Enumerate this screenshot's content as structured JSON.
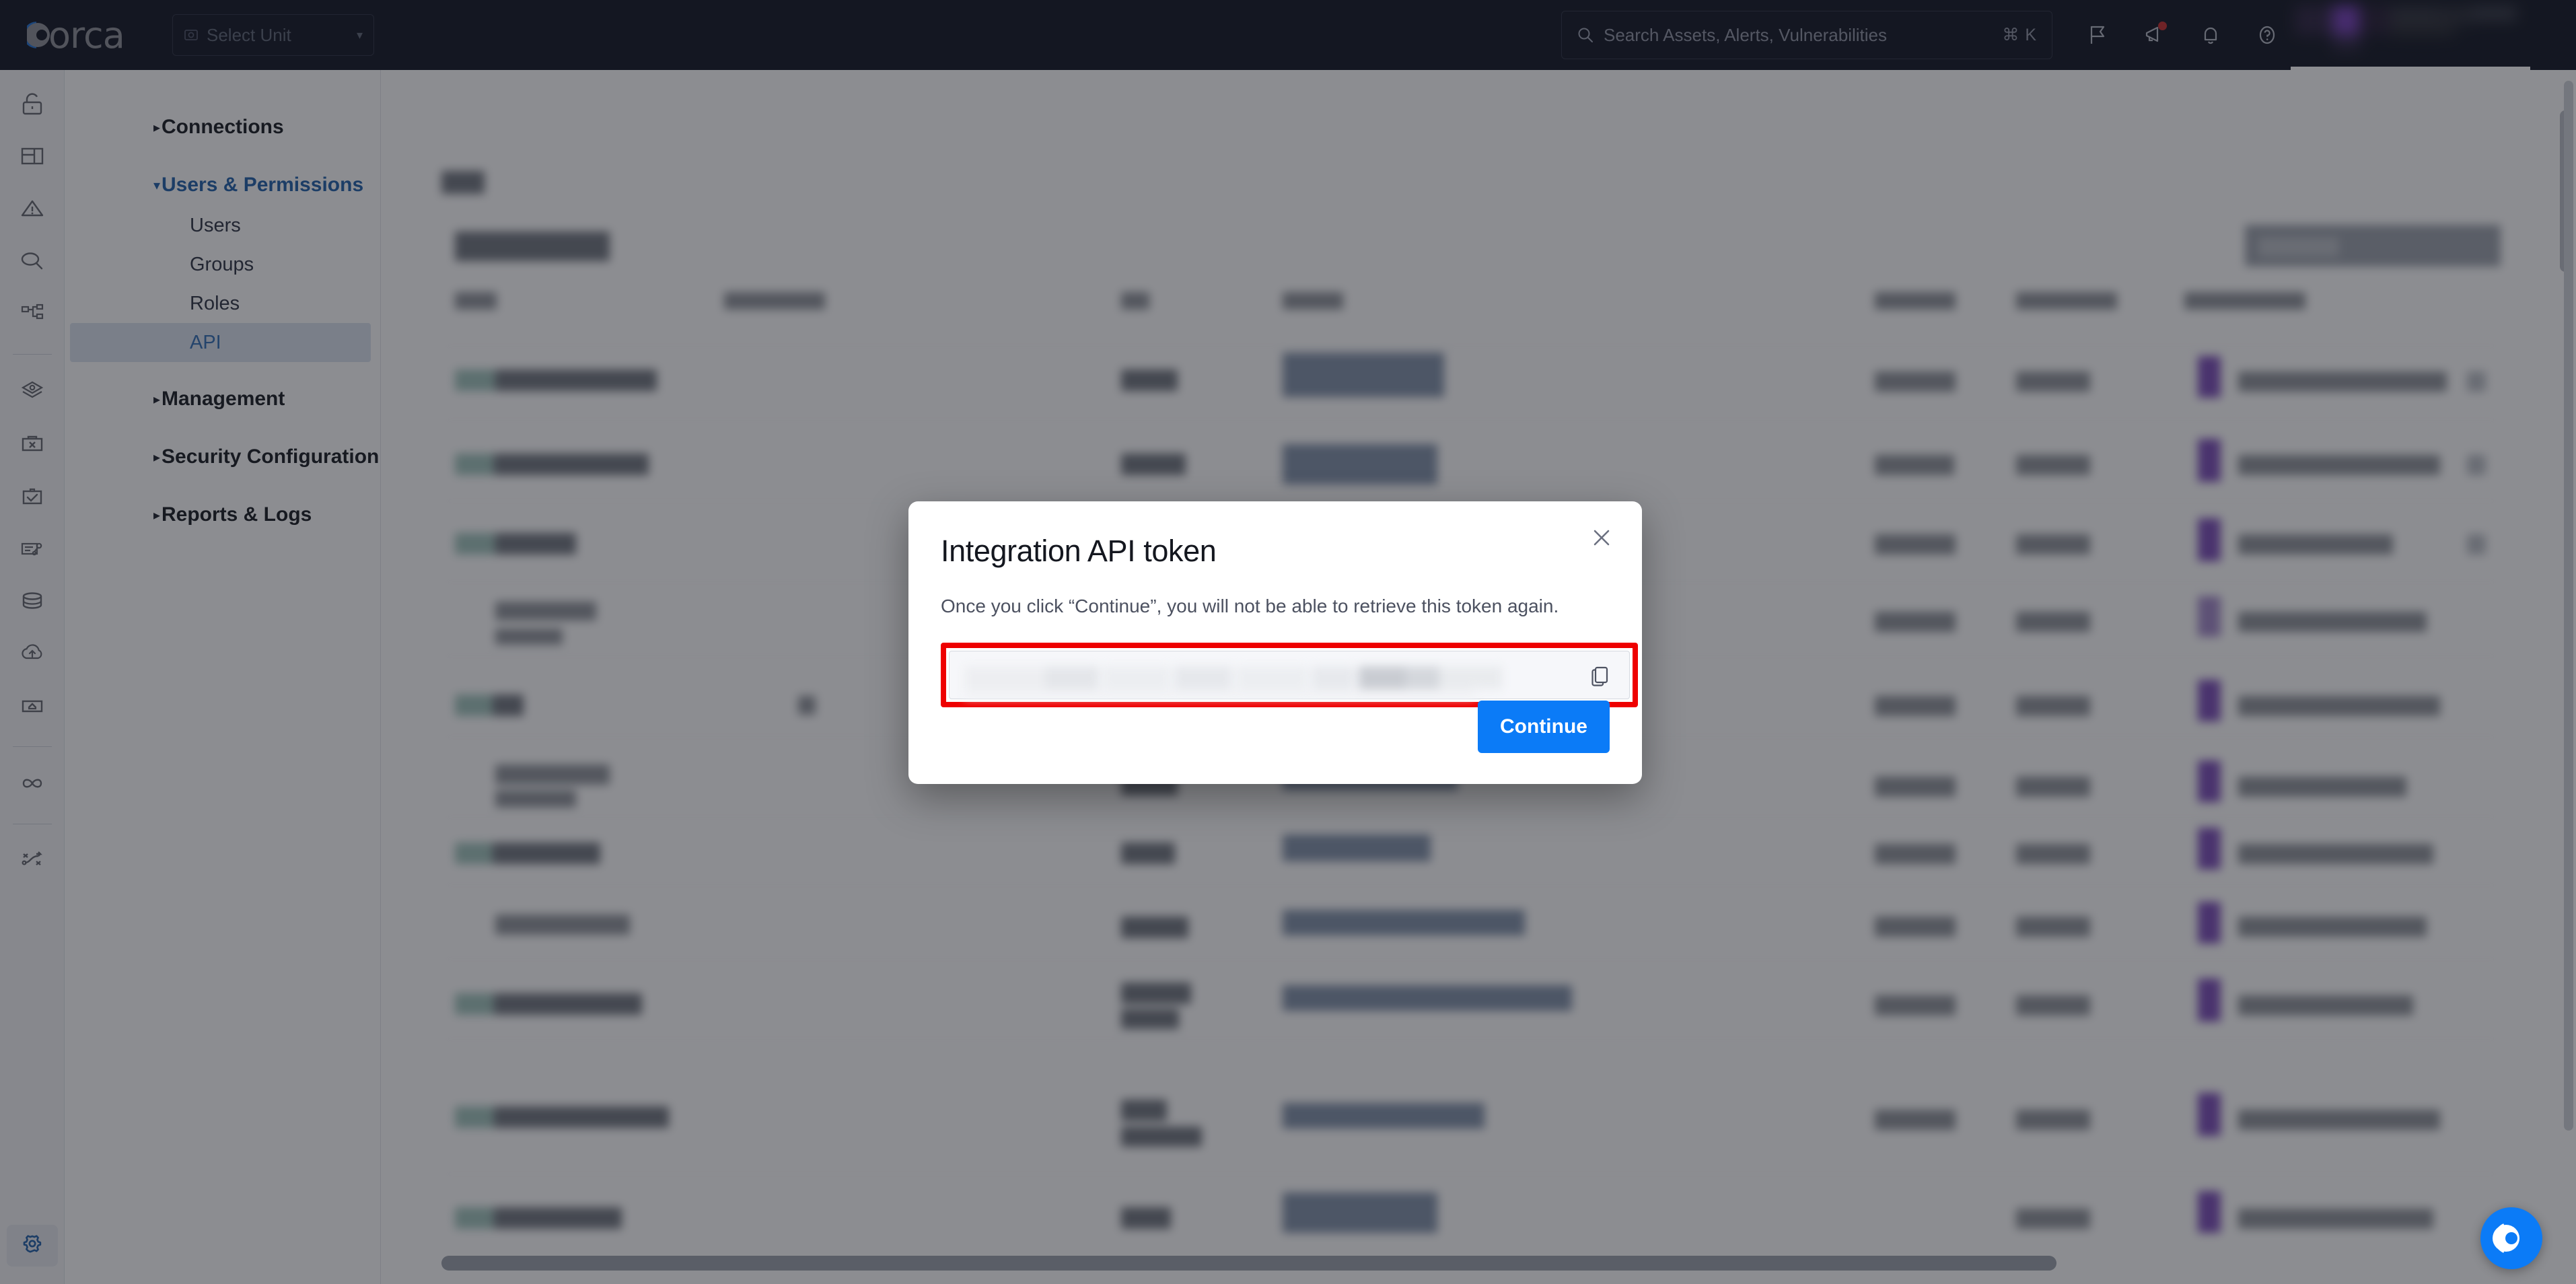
{
  "topbar": {
    "logo_text": "orca",
    "unit_select": {
      "label": "Select Unit",
      "icon": "unit-icon",
      "caret": "▾"
    },
    "search": {
      "placeholder": "Search Assets, Alerts, Vulnerabilities",
      "shortcut": "⌘ K",
      "icon": "search-icon"
    },
    "actions": [
      {
        "name": "flag-icon",
        "badge": false
      },
      {
        "name": "megaphone-icon",
        "badge": true
      },
      {
        "name": "bell-icon",
        "badge": false
      },
      {
        "name": "help-icon",
        "badge": false
      }
    ]
  },
  "rail": {
    "icons": [
      "unlock-icon",
      "dashboard-icon",
      "alerts-warning-icon",
      "search-discovery-icon",
      "topology-icon",
      "assets-network-icon",
      "toolbox-icon",
      "compliance-check-icon",
      "reports-key-icon",
      "database-icon",
      "cloud-upload-icon",
      "inbox-icon",
      "infinity-icon",
      "shuffle-paths-icon"
    ],
    "settings_icon": "gear-icon"
  },
  "sidebar": {
    "groups": [
      {
        "label": "Connections",
        "expanded": false,
        "caret": "▸",
        "items": []
      },
      {
        "label": "Users & Permissions",
        "expanded": true,
        "caret": "▾",
        "items": [
          {
            "label": "Users",
            "selected": false
          },
          {
            "label": "Groups",
            "selected": false
          },
          {
            "label": "Roles",
            "selected": false
          },
          {
            "label": "API",
            "selected": true
          }
        ]
      },
      {
        "label": "Management",
        "expanded": false,
        "caret": "▸",
        "items": []
      },
      {
        "label": "Security Configuration",
        "expanded": false,
        "caret": "▸",
        "items": []
      },
      {
        "label": "Reports & Logs",
        "expanded": false,
        "caret": "▸",
        "items": []
      }
    ]
  },
  "modal": {
    "title": "Integration API token",
    "description": "Once you click “Continue”, you will not be able to retrieve this token again.",
    "token_value": "",
    "copy_icon": "copy-icon",
    "close_icon": "close-icon",
    "continue_label": "Continue",
    "highlight_color": "#ee0000",
    "accent_color": "#0b7bf7"
  },
  "fab": {
    "icon": "orca-chat-icon",
    "color": "#0b7bf7"
  },
  "colors": {
    "topbar_bg": "#0f1320",
    "accent_blue": "#0b7bf7",
    "nav_active": "#1f5ea8",
    "nav_selected_bg": "#dbe3ee",
    "badge_purple": "#7a4ab8",
    "overlay": "rgba(25,28,36,0.5)"
  }
}
